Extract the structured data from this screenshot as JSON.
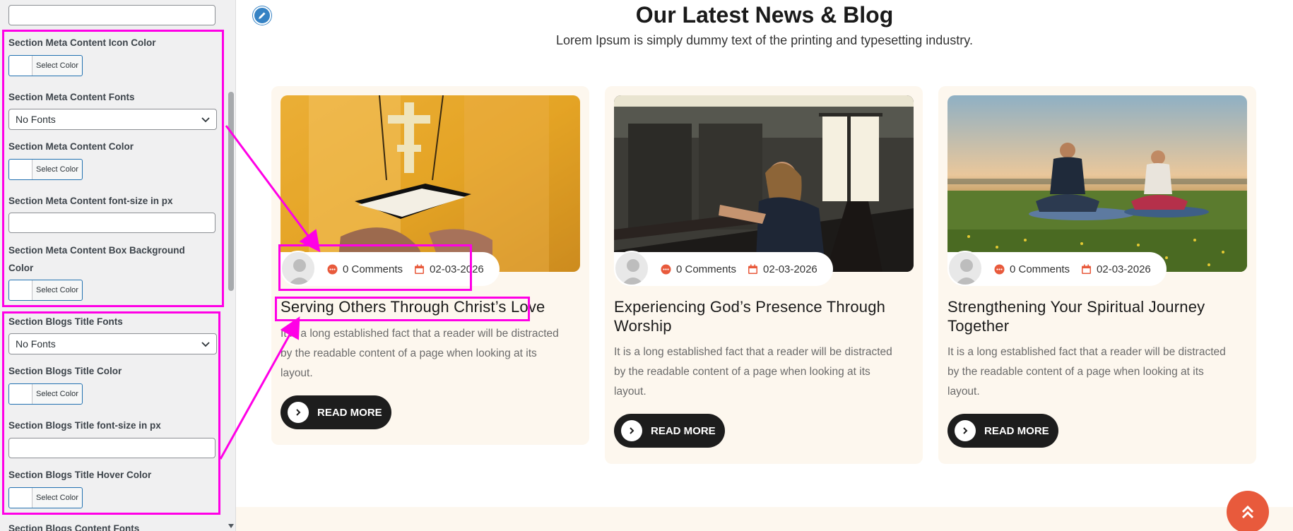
{
  "sidebar": {
    "fields": [
      {
        "label": "Section Meta Content Icon Color",
        "color_label": "Select Color"
      },
      {
        "label": "Section Meta Content Fonts",
        "select_value": "No Fonts"
      },
      {
        "label": "Section Meta Content Color",
        "color_label": "Select Color"
      },
      {
        "label": "Section Meta Content font-size in px",
        "input_value": ""
      },
      {
        "label_line1": "Section Meta Content Box Background",
        "label_line2": "Color",
        "color_label": "Select Color"
      },
      {
        "label": "Section Blogs Title Fonts",
        "select_value": "No Fonts"
      },
      {
        "label": "Section Blogs Title Color",
        "color_label": "Select Color"
      },
      {
        "label": "Section Blogs Title font-size in px",
        "input_value": ""
      },
      {
        "label": "Section Blogs Title Hover Color",
        "color_label": "Select Color"
      },
      {
        "label": "Section Blogs Content Fonts"
      }
    ]
  },
  "main": {
    "title": "Our Latest News & Blog",
    "subtitle": "Lorem Ipsum is simply dummy text of the printing and typesetting industry.",
    "cards": [
      {
        "comments": "0 Comments",
        "date": "02-03-2026",
        "title_lines": [
          "Serving Others Through Christ’s Love"
        ],
        "text_lines": [
          "It is a long established fact that a reader will be distracted",
          "by the readable content of a page when looking at its",
          "layout."
        ],
        "button": "READ MORE"
      },
      {
        "comments": "0 Comments",
        "date": "02-03-2026",
        "title_lines": [
          "Experiencing God’s Presence Through",
          "Worship"
        ],
        "text_lines": [
          "It is a long established fact that a reader will be distracted",
          "by the readable content of a page when looking at its",
          "layout."
        ],
        "button": "READ MORE"
      },
      {
        "comments": "0 Comments",
        "date": "02-03-2026",
        "title_lines": [
          "Strengthening Your Spiritual Journey",
          "Together"
        ],
        "text_lines": [
          "It is a long established fact that a reader will be distracted",
          "by the readable content of a page when looking at its",
          "layout."
        ],
        "button": "READ MORE"
      }
    ]
  },
  "icons": {
    "edit": "pencil-icon",
    "comment": "comment-icon",
    "calendar": "calendar-icon",
    "read_more": "chevron-right-icon",
    "scroll_top": "double-chevron-up-icon",
    "select": "chevron-down-icon"
  },
  "colors": {
    "highlight": "#ff00e6",
    "card_bg": "#fdf7ee",
    "accent": "#e85a3c",
    "button_bg": "#1d1d1d",
    "edit_icon": "#3582c4"
  }
}
